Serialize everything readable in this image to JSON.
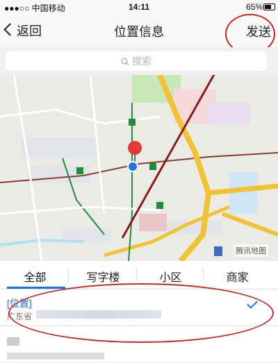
{
  "status": {
    "carrier": "●●●○○ 中国移动",
    "time": "14:11",
    "battery": "65%"
  },
  "nav": {
    "back_label": "返回",
    "title": "位置信息",
    "send_label": "发送"
  },
  "search": {
    "placeholder": "搜索"
  },
  "map": {
    "attribution": "腾讯地图"
  },
  "tabs": [
    {
      "label": "全部",
      "active": true
    },
    {
      "label": "写字楼",
      "active": false
    },
    {
      "label": "小区",
      "active": false
    },
    {
      "label": "商家",
      "active": false
    }
  ],
  "list": [
    {
      "name": "[位置]",
      "address": "广东省",
      "selected": true
    }
  ],
  "colors": {
    "accent": "#1a73e8",
    "annotation": "#c62828",
    "pin_red": "#e53935"
  }
}
